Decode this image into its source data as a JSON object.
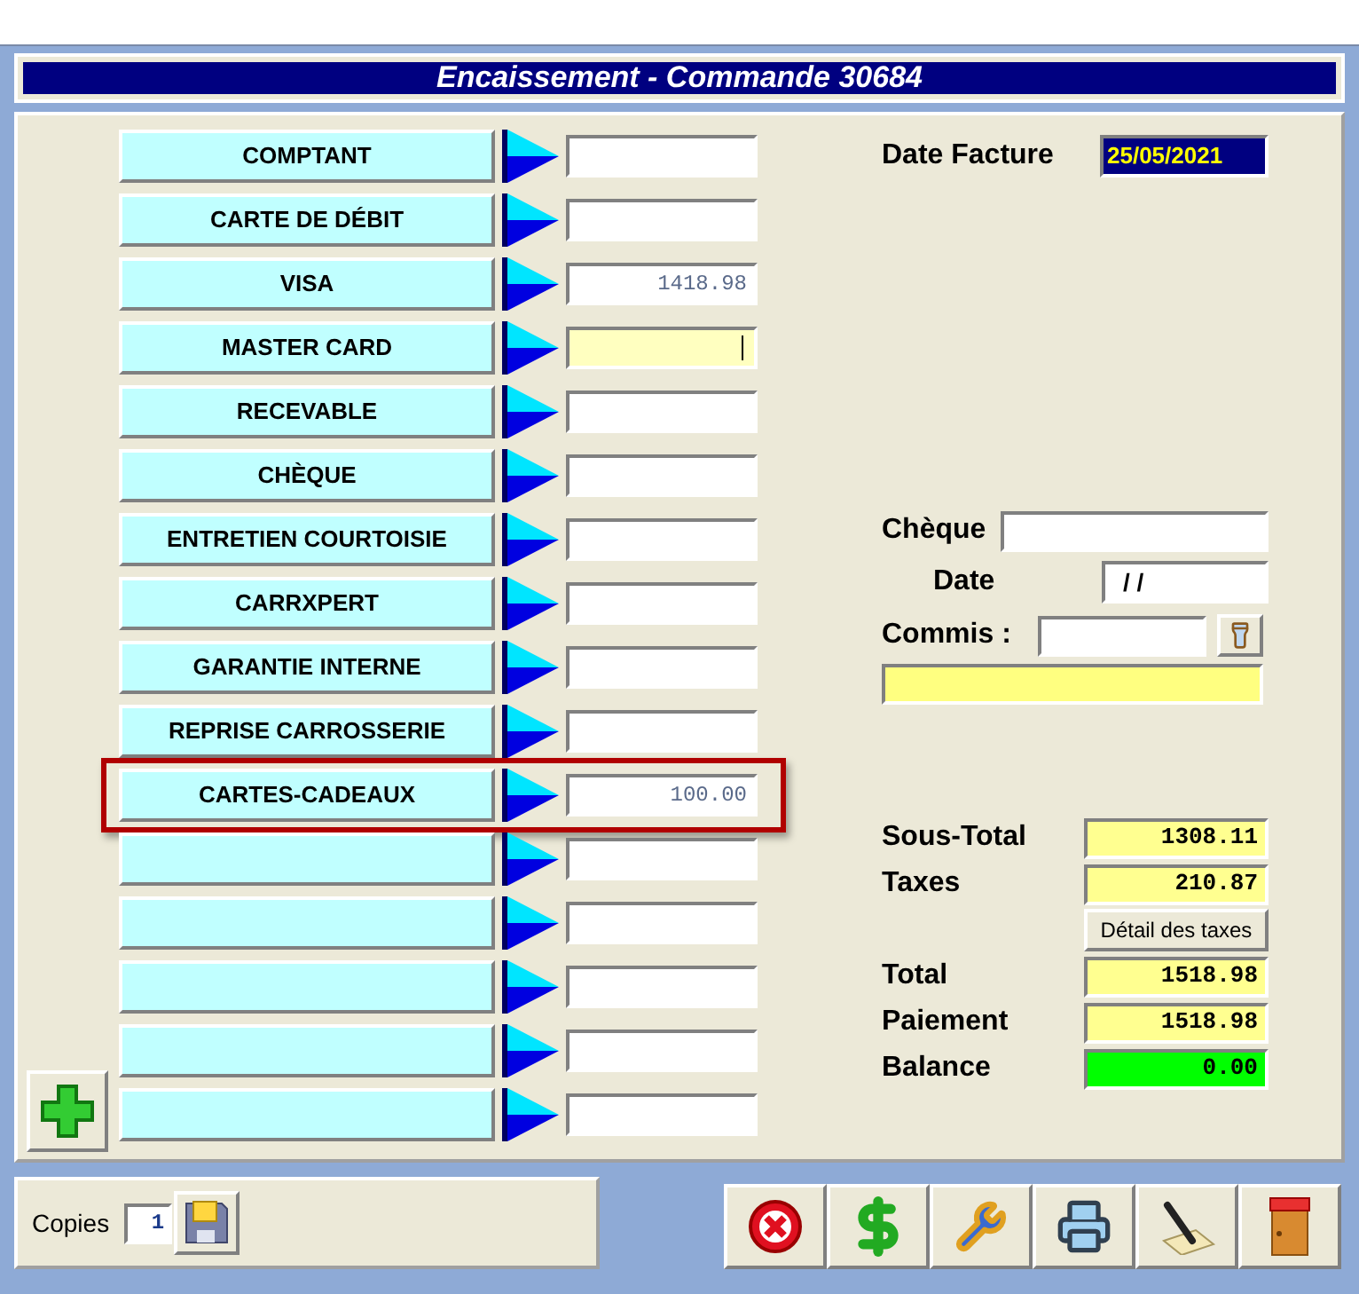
{
  "window": {
    "title": "Encaissement - Commande 30684"
  },
  "payment_methods": [
    {
      "label": "COMPTANT",
      "focused": false,
      "highlighted": false
    },
    {
      "label": "CARTE DE DÉBIT",
      "focused": false,
      "highlighted": false
    },
    {
      "label": "VISA",
      "amount": "1418.98",
      "focused": false,
      "highlighted": false
    },
    {
      "label": "MASTER CARD",
      "focused": true,
      "highlighted": false
    },
    {
      "label": "RECEVABLE",
      "focused": false,
      "highlighted": false
    },
    {
      "label": "CHÈQUE",
      "focused": false,
      "highlighted": false
    },
    {
      "label": "ENTRETIEN COURTOISIE",
      "focused": false,
      "highlighted": false
    },
    {
      "label": "CARRXPERT",
      "focused": false,
      "highlighted": false
    },
    {
      "label": "GARANTIE INTERNE",
      "focused": false,
      "highlighted": false
    },
    {
      "label": "REPRISE CARROSSERIE",
      "focused": false,
      "highlighted": false
    },
    {
      "label": "CARTES-CADEAUX",
      "amount": "100.00",
      "focused": false,
      "highlighted": true
    },
    {
      "focused": false,
      "highlighted": false
    },
    {
      "focused": false,
      "highlighted": false
    },
    {
      "focused": false,
      "highlighted": false
    },
    {
      "focused": false,
      "highlighted": false
    },
    {
      "focused": false,
      "highlighted": false
    }
  ],
  "invoice_date": {
    "label": "Date Facture",
    "value": "25/05/2021"
  },
  "cheque": {
    "label": "Chèque"
  },
  "cheque_date": {
    "label": "Date",
    "value": "/ /"
  },
  "clerk": {
    "label": "Commis :"
  },
  "summary": [
    {
      "kind": "amount",
      "label": "Sous-Total",
      "value": "1308.11"
    },
    {
      "kind": "amount",
      "label": "Taxes",
      "value": "210.87"
    },
    {
      "kind": "button",
      "label": "Détail des taxes"
    },
    {
      "kind": "amount",
      "label": "Total",
      "value": "1518.98"
    },
    {
      "kind": "amount",
      "label": "Paiement",
      "value": "1518.98"
    },
    {
      "kind": "balance",
      "label": "Balance",
      "value": "0.00"
    }
  ],
  "copies": {
    "label": "Copies",
    "value": "1"
  }
}
